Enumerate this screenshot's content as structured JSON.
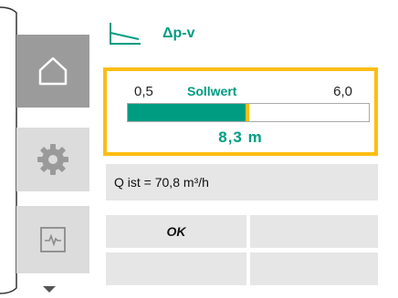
{
  "header": {
    "mode_icon": "control-curve-icon",
    "title": "Δp-v"
  },
  "sidebar": {
    "items": [
      {
        "id": "home",
        "icon": "home-icon",
        "active": true
      },
      {
        "id": "settings",
        "icon": "gear-icon",
        "active": false
      },
      {
        "id": "diagnostics",
        "icon": "pulse-monitor-icon",
        "active": false
      }
    ],
    "more_icon": "chevron-down-icon"
  },
  "setpoint": {
    "label": "Sollwert",
    "min_label": "0,5",
    "max_label": "6,0",
    "value_label": "8,3 m",
    "fill_fraction": 0.49
  },
  "info": {
    "text": "Q ist = 70,8 m³/h"
  },
  "softkeys": {
    "ok_label": "OK"
  },
  "colors": {
    "accent": "#009c82",
    "highlight": "#ffbd13",
    "nav_active": "#9b9b9b",
    "nav_inactive": "#dcdcdc",
    "panel_bg": "#e6e6e6"
  }
}
